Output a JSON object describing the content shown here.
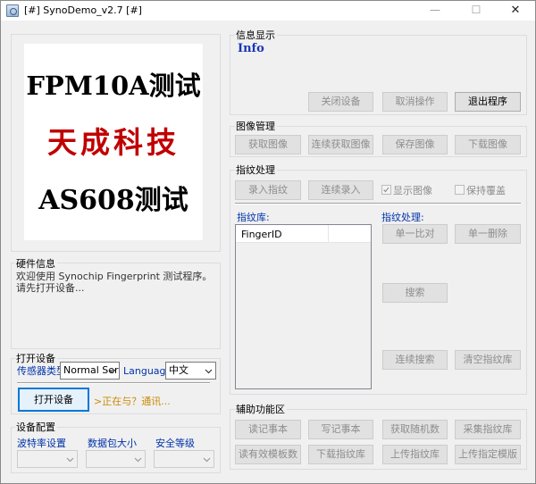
{
  "window": {
    "title": "[#] SynoDemo_v2.7 [#]",
    "controls": {
      "minimize": "—",
      "maximize": "☐",
      "close": "✕"
    }
  },
  "logo": {
    "line1": "FPM10A测试",
    "line2": "天成科技",
    "line3": "AS608测试",
    "line1_color": "#000000",
    "line2_color": "#c00000",
    "line3_color": "#000000"
  },
  "hardware": {
    "title": "硬件信息",
    "line1": "欢迎使用 Synochip Fingerprint 测试程序。",
    "line2": "请先打开设备..."
  },
  "open_device": {
    "title": "打开设备",
    "sensor_type_label": "传感器类型",
    "sensor_type_value": "Normal Ser",
    "language_label": "Language",
    "language_value": "中文",
    "open_button": "打开设备",
    "status_text": ">正在与？通讯..."
  },
  "device_config": {
    "title": "设备配置",
    "baud_label": "波特率设置",
    "packet_label": "数据包大小",
    "security_label": "安全等级"
  },
  "info_display": {
    "title": "信息显示",
    "info_text": "Info",
    "close_device_button": "关闭设备",
    "cancel_button": "取消操作",
    "exit_button": "退出程序"
  },
  "image_manage": {
    "title": "图像管理",
    "buttons": [
      "获取图像",
      "连续获取图像",
      "保存图像",
      "下载图像"
    ]
  },
  "fingerprint_process": {
    "title": "指纹处理",
    "enroll_button": "录入指纹",
    "continuous_enroll_button": "连续录入",
    "show_image_label": "显示图像",
    "show_image_checked": true,
    "keep_cover_label": "保持覆盖",
    "keep_cover_checked": false,
    "library_label": "指纹库:",
    "process_label": "指纹处理:",
    "table_header": "FingerID",
    "match_one_button": "单一比对",
    "delete_one_button": "单一删除",
    "search_button": "搜索",
    "continuous_search_button": "连续搜索",
    "clear_library_button": "清空指纹库"
  },
  "aux": {
    "title": "辅助功能区",
    "row1": [
      "读记事本",
      "写记事本",
      "获取随机数",
      "采集指纹库"
    ],
    "row2": [
      "读有效模板数",
      "下载指纹库",
      "上传指纹库",
      "上传指定模版"
    ]
  }
}
